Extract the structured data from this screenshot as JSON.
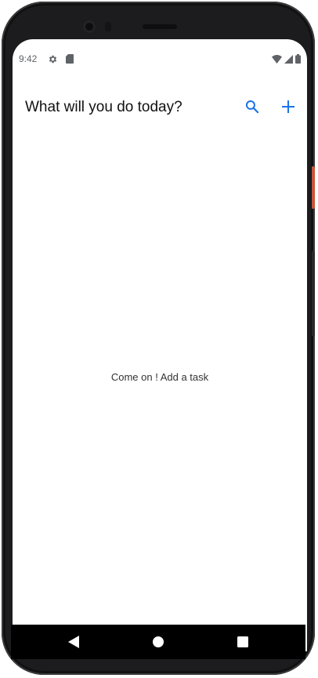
{
  "status_bar": {
    "time": "9:42",
    "icons": [
      "gear-icon",
      "sd-card-icon",
      "wifi-icon",
      "signal-icon",
      "battery-icon"
    ]
  },
  "app_bar": {
    "title": "What will you do today?",
    "actions": [
      {
        "icon": "search-icon",
        "color": "#1a73e8"
      },
      {
        "icon": "plus-icon",
        "color": "#1a73e8"
      }
    ]
  },
  "main": {
    "empty_message": "Come on ! Add a task"
  },
  "nav_bar": {
    "buttons": [
      "back-icon",
      "home-icon",
      "recents-icon"
    ]
  },
  "colors": {
    "accent": "#1a73e8",
    "status_icons": "#5f6368",
    "frame": "#1c1c1e",
    "power_button": "#c8553a"
  }
}
